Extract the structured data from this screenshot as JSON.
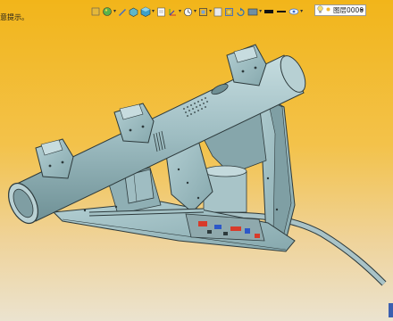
{
  "statusbar": {
    "hint": "意提示。"
  },
  "toolbar": {
    "icons": [
      "render-icon",
      "color-icon",
      "edit-icon",
      "view-cube-icon",
      "shaded-icon",
      "sheet-icon",
      "axis-icon",
      "clock-icon",
      "frame-icon",
      "zoom-fit-icon",
      "zoom-window-icon",
      "rotate-icon",
      "rectangle-icon",
      "line-color-icon",
      "line-weight-icon",
      "visibility-icon"
    ],
    "layer_value": "图层0000"
  },
  "colors": {
    "bg_top": "#f2b51a",
    "bg_bottom": "#ebe3cf",
    "part": "#9fbfc4",
    "part_dark": "#6f9196",
    "outline": "#2d3a3c",
    "accent_red": "#d83b2b",
    "accent_blue": "#2d58c8"
  }
}
